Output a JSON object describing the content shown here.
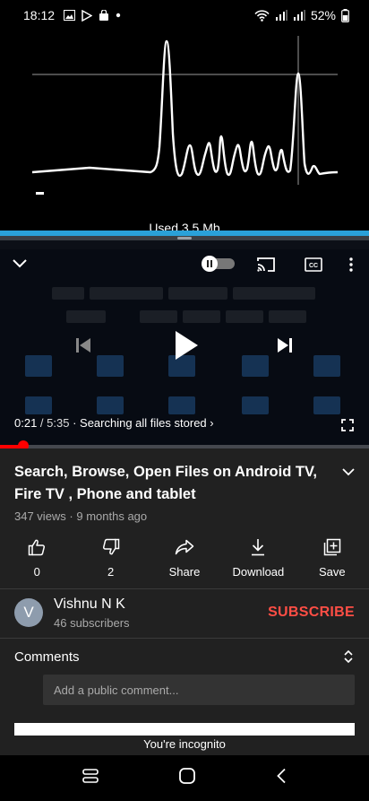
{
  "status_bar": {
    "time": "18:12",
    "battery": "52%"
  },
  "graph": {
    "used_label": "Used 3.5 Mb"
  },
  "player": {
    "current_time": "0:21",
    "separator": " / ",
    "duration": "5:35",
    "chapter": " · Searching all files stored ›",
    "progress": 0.063
  },
  "video": {
    "title": "Search, Browse, Open Files on Android TV, Fire TV , Phone and tablet",
    "meta": "347 views · 9 months ago"
  },
  "actions": [
    {
      "id": "like",
      "label": "0",
      "icon": "thumbs-up-icon"
    },
    {
      "id": "dislike",
      "label": "2",
      "icon": "thumbs-down-icon"
    },
    {
      "id": "share",
      "label": "Share",
      "icon": "share-icon"
    },
    {
      "id": "download",
      "label": "Download",
      "icon": "download-icon"
    },
    {
      "id": "save",
      "label": "Save",
      "icon": "add-to-playlist-icon"
    }
  ],
  "channel": {
    "avatar_letter": "V",
    "name": "Vishnu N K",
    "subscribers": "46 subscribers",
    "subscribe_label": "SUBSCRIBE"
  },
  "comments": {
    "label": "Comments",
    "placeholder": "Add a public comment..."
  },
  "incognito": {
    "label": "You're incognito"
  },
  "colors": {
    "accent_red": "#ff0000",
    "subscribe_red": "#ff4e45",
    "split_blue": "#2aa1d8",
    "panel_bg": "#212121"
  }
}
